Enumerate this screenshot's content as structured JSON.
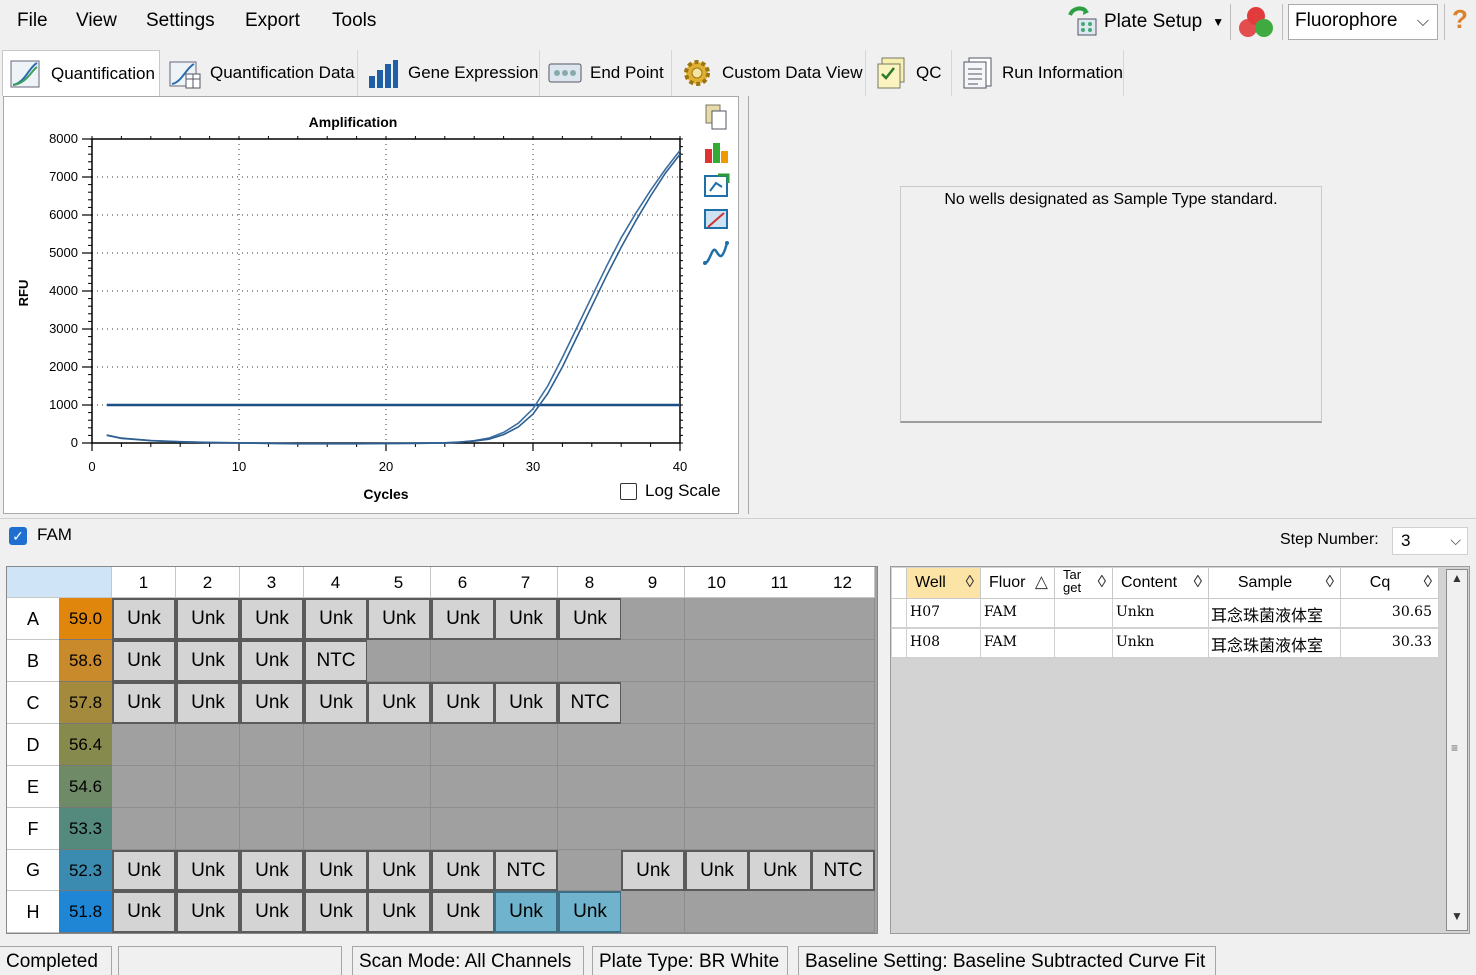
{
  "menu": {
    "items": [
      "File",
      "View",
      "Settings",
      "Export",
      "Tools"
    ],
    "plate_setup": "Plate Setup",
    "fluorophore": "Fluorophore"
  },
  "tabs": [
    {
      "label": "Quantification",
      "icon": "amplification-curve-icon",
      "active": true
    },
    {
      "label": "Quantification Data",
      "icon": "quantification-data-icon"
    },
    {
      "label": "Gene Expression",
      "icon": "bar-chart-icon"
    },
    {
      "label": "End Point",
      "icon": "end-point-icon"
    },
    {
      "label": "Custom Data View",
      "icon": "gear-icon"
    },
    {
      "label": "QC",
      "icon": "qc-checklist-icon"
    },
    {
      "label": "Run Information",
      "icon": "document-icon"
    }
  ],
  "chart_data": {
    "type": "line",
    "title": "Amplification",
    "xlabel": "Cycles",
    "ylabel": "RFU",
    "xlim": [
      0,
      40
    ],
    "ylim": [
      0,
      8000
    ],
    "xticks": [
      0,
      10,
      20,
      30,
      40
    ],
    "yticks": [
      0,
      1000,
      2000,
      3000,
      4000,
      5000,
      6000,
      7000,
      8000
    ],
    "grid": true,
    "threshold": 1000,
    "x": [
      1,
      2,
      4,
      6,
      8,
      10,
      12,
      14,
      16,
      18,
      20,
      22,
      24,
      25,
      26,
      27,
      28,
      29,
      30,
      31,
      32,
      33,
      34,
      35,
      36,
      37,
      38,
      39,
      40
    ],
    "series": [
      {
        "values": [
          200,
          120,
          60,
          30,
          10,
          0,
          -10,
          -20,
          -20,
          -20,
          -15,
          -10,
          0,
          20,
          60,
          130,
          280,
          520,
          900,
          1500,
          2250,
          3050,
          3850,
          4650,
          5400,
          6050,
          6650,
          7200,
          7700
        ]
      },
      {
        "values": [
          210,
          130,
          65,
          35,
          15,
          5,
          -5,
          -15,
          -15,
          -15,
          -10,
          -5,
          5,
          25,
          50,
          100,
          220,
          420,
          760,
          1300,
          2000,
          2800,
          3600,
          4400,
          5150,
          5850,
          6500,
          7100,
          7600
        ]
      }
    ]
  },
  "log_scale_label": "Log Scale",
  "no_standard_message": "No wells designated as Sample Type standard.",
  "fam_label": "FAM",
  "step_number_label": "Step Number:",
  "step_number_value": "3",
  "plate": {
    "columns": [
      "1",
      "2",
      "3",
      "4",
      "5",
      "6",
      "7",
      "8",
      "9",
      "10",
      "11",
      "12"
    ],
    "rows": [
      {
        "label": "A",
        "temp": "59.0",
        "temp_color": "#e0860c",
        "wells": [
          "Unk",
          "Unk",
          "Unk",
          "Unk",
          "Unk",
          "Unk",
          "Unk",
          "Unk",
          "",
          "",
          "",
          ""
        ]
      },
      {
        "label": "B",
        "temp": "58.6",
        "temp_color": "#c88a2a",
        "wells": [
          "Unk",
          "Unk",
          "Unk",
          "NTC",
          "",
          "",
          "",
          "",
          "",
          "",
          "",
          ""
        ]
      },
      {
        "label": "C",
        "temp": "57.8",
        "temp_color": "#a48a3c",
        "wells": [
          "Unk",
          "Unk",
          "Unk",
          "Unk",
          "Unk",
          "Unk",
          "Unk",
          "NTC",
          "",
          "",
          "",
          ""
        ]
      },
      {
        "label": "D",
        "temp": "56.4",
        "temp_color": "#868a4c",
        "wells": [
          "",
          "",
          "",
          "",
          "",
          "",
          "",
          "",
          "",
          "",
          "",
          ""
        ]
      },
      {
        "label": "E",
        "temp": "54.6",
        "temp_color": "#6e8a66",
        "wells": [
          "",
          "",
          "",
          "",
          "",
          "",
          "",
          "",
          "",
          "",
          "",
          ""
        ]
      },
      {
        "label": "F",
        "temp": "53.3",
        "temp_color": "#548a7d",
        "wells": [
          "",
          "",
          "",
          "",
          "",
          "",
          "",
          "",
          "",
          "",
          "",
          ""
        ]
      },
      {
        "label": "G",
        "temp": "52.3",
        "temp_color": "#3b8bb0",
        "wells": [
          "Unk",
          "Unk",
          "Unk",
          "Unk",
          "Unk",
          "Unk",
          "NTC",
          "",
          "Unk",
          "Unk",
          "Unk",
          "NTC"
        ]
      },
      {
        "label": "H",
        "temp": "51.8",
        "temp_color": "#1e86d4",
        "wells": [
          "Unk",
          "Unk",
          "Unk",
          "Unk",
          "Unk",
          "Unk",
          "Unk",
          "Unk",
          "",
          "",
          "",
          ""
        ],
        "selected": [
          6,
          7
        ]
      }
    ]
  },
  "results_table": {
    "headers": [
      "Well",
      "Fluor",
      "Tar get",
      "Content",
      "Sample",
      "Cq"
    ],
    "rows": [
      [
        "H07",
        "FAM",
        "",
        "Unkn",
        "耳念珠菌液体室",
        "30.65"
      ],
      [
        "H08",
        "FAM",
        "",
        "Unkn",
        "耳念珠菌液体室",
        "30.33"
      ]
    ]
  },
  "status": {
    "state": "Completed",
    "scan_mode": "Scan Mode: All Channels",
    "plate_type": "Plate Type: BR White",
    "baseline": "Baseline Setting: Baseline Subtracted Curve Fit"
  }
}
